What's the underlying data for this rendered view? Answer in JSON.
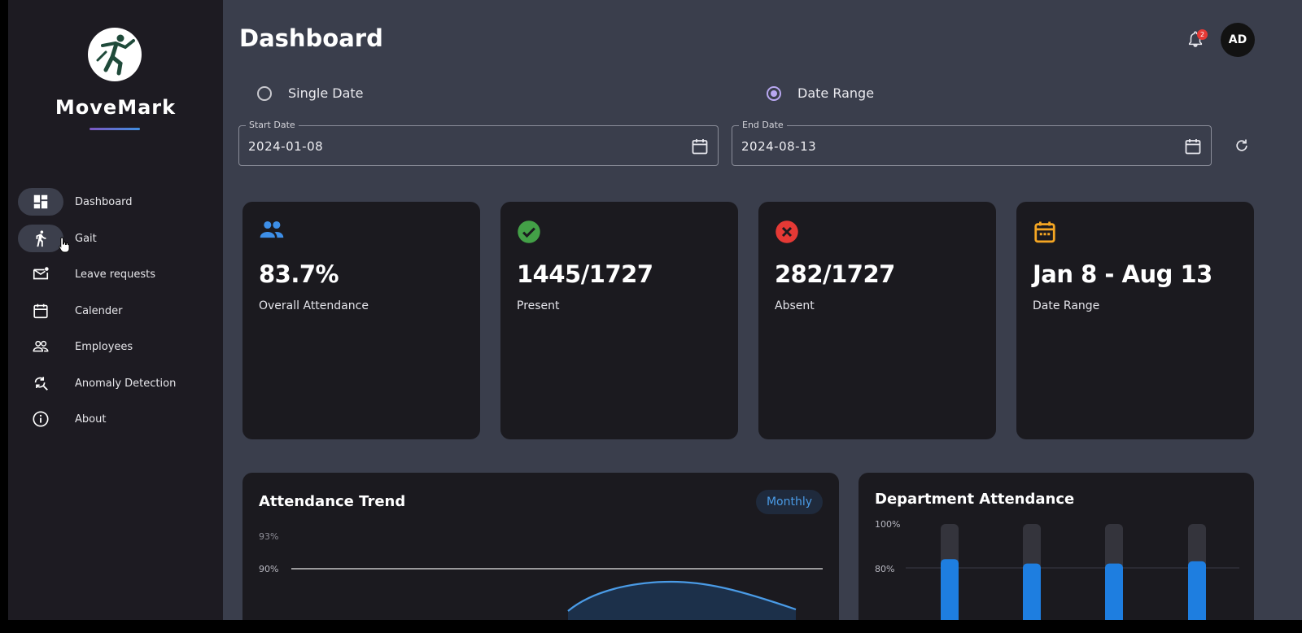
{
  "sidebar": {
    "brand": "MoveMark",
    "items": [
      {
        "label": "Dashboard",
        "icon": "dashboard-icon"
      },
      {
        "label": "Gait",
        "icon": "walk-icon"
      },
      {
        "label": "Leave requests",
        "icon": "mail-icon"
      },
      {
        "label": "Calender",
        "icon": "calendar-icon"
      },
      {
        "label": "Employees",
        "icon": "people-icon"
      },
      {
        "label": "Anomaly Detection",
        "icon": "search-refresh-icon"
      },
      {
        "label": "About",
        "icon": "info-icon"
      }
    ]
  },
  "header": {
    "title": "Dashboard",
    "notification_count": "2",
    "avatar_initials": "AD"
  },
  "filters": {
    "single_date_label": "Single Date",
    "date_range_label": "Date Range",
    "selected": "Date Range",
    "start_label": "Start Date",
    "start_value": "2024-01-08",
    "end_label": "End Date",
    "end_value": "2024-08-13"
  },
  "stats": [
    {
      "value": "83.7%",
      "label": "Overall Attendance",
      "icon": "people-icon",
      "color": "#3d8fe8"
    },
    {
      "value": "1445/1727",
      "label": "Present",
      "icon": "check-circle-icon",
      "color": "#43a047"
    },
    {
      "value": "282/1727",
      "label": "Absent",
      "icon": "cancel-circle-icon",
      "color": "#e53935"
    },
    {
      "value": "Jan 8 - Aug 13",
      "label": "Date Range",
      "icon": "event-icon",
      "color": "#f5a623"
    }
  ],
  "trend": {
    "title": "Attendance Trend",
    "period": "Monthly",
    "chart_data": {
      "type": "line",
      "yticks": [
        "93%",
        "90%"
      ],
      "y_visible_range": [
        88,
        93
      ],
      "reference_line": 90,
      "visible_points": [
        87.6,
        88.4,
        87.7
      ]
    }
  },
  "department": {
    "title": "Department Attendance",
    "chart_data": {
      "type": "bar",
      "yticks": [
        "100%",
        "80%"
      ],
      "ylim": [
        0,
        100
      ],
      "values": [
        84,
        82,
        82,
        83
      ]
    }
  },
  "colors": {
    "accent": "#b8a7f0",
    "line": "#4a9be6",
    "bar": "#1e7ee0"
  }
}
